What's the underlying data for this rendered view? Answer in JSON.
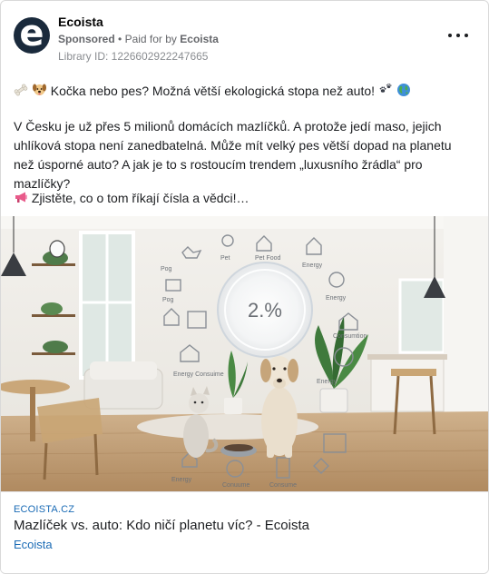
{
  "header": {
    "avatar_letter": "e",
    "page_name": "Ecoista",
    "sponsored": "Sponsored",
    "separator": "•",
    "paid_for_by": "Paid for by",
    "paid_for_by_name": "Ecoista",
    "library_id": "Library ID: 1226602922247665"
  },
  "post": {
    "line1_text": "Kočka nebo pes? Možná větší ekologická stopa než auto!",
    "paragraph": "V Česku je už přes 5 milionů domácích mazlíčků. A protože jedí maso, jejich uhlíková stopa není zanedbatelná. Může mít velký pes větší dopad na planetu než úsporné auto? A jak je to s rostoucím trendem „luxusního žrádla“ pro mazlíčky?",
    "line3_text": "Zjistěte, co o tom říkají čísla a vědci!…"
  },
  "image": {
    "center_value": "2.%",
    "labels": [
      "Pog",
      "Pet",
      "Pet Food",
      "Energy",
      "Pog",
      "Energy",
      "Energy Consuime",
      "Consumtion",
      "Energy",
      "Energy",
      "Conuume",
      "Consume"
    ]
  },
  "link": {
    "domain": "ECOISTA.CZ",
    "title": "Mazlíček vs. auto: Kdo ničí planetu víc? - Ecoista",
    "brand": "Ecoista"
  },
  "colors": {
    "accent_link": "#1a6bb5",
    "avatar_bg": "#1a2a3c"
  }
}
